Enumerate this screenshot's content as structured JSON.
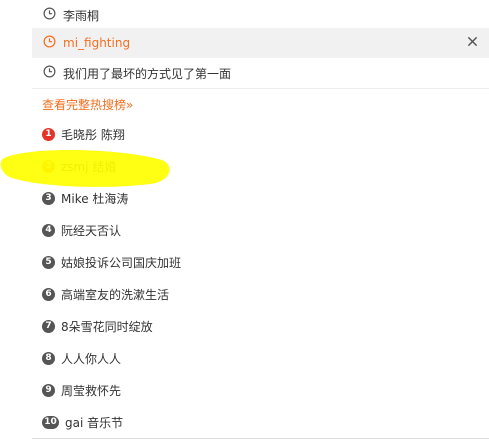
{
  "history": [
    {
      "text": "李雨桐",
      "icon": "clock-icon"
    },
    {
      "text": "mi_fighting",
      "icon": "clock-icon"
    },
    {
      "text": "我们用了最坏的方式见了第一面",
      "icon": "clock-icon"
    }
  ],
  "close_icon": "close-icon",
  "more_link": "查看完整热搜榜»",
  "hot_list": [
    {
      "rank": "1",
      "text": "毛晓彤 陈翔",
      "color": "#e5332b"
    },
    {
      "rank": "2",
      "text": "zsmj 结婚",
      "color": "#f36f21"
    },
    {
      "rank": "3",
      "text": "Mike 杜海涛",
      "color": "#555555"
    },
    {
      "rank": "4",
      "text": "阮经天否认",
      "color": "#555555"
    },
    {
      "rank": "5",
      "text": "姑娘投诉公司国庆加班",
      "color": "#555555"
    },
    {
      "rank": "6",
      "text": "高端室友的洗漱生活",
      "color": "#555555"
    },
    {
      "rank": "7",
      "text": "8朵雪花同时绽放",
      "color": "#555555"
    },
    {
      "rank": "8",
      "text": "人人你人人",
      "color": "#555555"
    },
    {
      "rank": "9",
      "text": "周莹救怀先",
      "color": "#555555"
    },
    {
      "rank": "10",
      "text": "gai 音乐节",
      "color": "#555555"
    }
  ],
  "colors": {
    "accent": "#f36f21",
    "highlighter": "#ffff00"
  }
}
